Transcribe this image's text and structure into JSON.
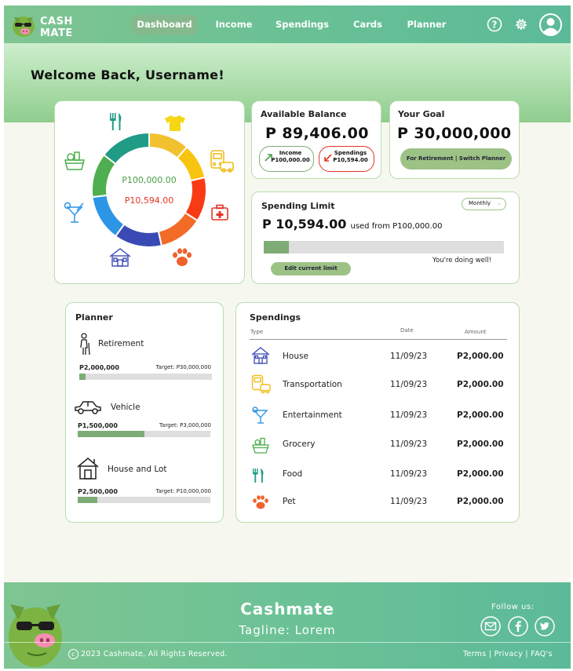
{
  "brand": {
    "line1": "CASH",
    "line2": "MATE"
  },
  "nav": [
    {
      "label": "Dashboard",
      "active": true
    },
    {
      "label": "Income"
    },
    {
      "label": "Spendings"
    },
    {
      "label": "Cards"
    },
    {
      "label": "Planner"
    }
  ],
  "header_icons": [
    "help-icon",
    "settings-gear-icon",
    "user-avatar-icon"
  ],
  "welcome": "Welcome Back, Username!",
  "donut": {
    "income": "P100,000.00",
    "spent": "P10,594.00",
    "segments": [
      {
        "name": "Clothing",
        "color": "#f2c12e",
        "frac": 0.115
      },
      {
        "name": "Transportation",
        "color": "#f8c40f",
        "frac": 0.1
      },
      {
        "name": "Health",
        "color": "#f83b14",
        "frac": 0.125
      },
      {
        "name": "Pet",
        "color": "#f26b27",
        "frac": 0.125
      },
      {
        "name": "House",
        "color": "#3a4ab5",
        "frac": 0.135
      },
      {
        "name": "Entertainment",
        "color": "#2d95e6",
        "frac": 0.13
      },
      {
        "name": "Grocery",
        "color": "#4fae4f",
        "frac": 0.125
      },
      {
        "name": "Food",
        "color": "#1f9b86",
        "frac": 0.145
      }
    ]
  },
  "balance": {
    "title": "Available Balance",
    "amount": "P 89,406.00",
    "income_label": "Income",
    "income_value": "P100,000.00",
    "spendings_label": "Spendings",
    "spendings_value": "P10,594.00"
  },
  "goal": {
    "title": "Your Goal",
    "amount": "P 30,000,000",
    "button": "For Retirement | Switch Planner"
  },
  "limit": {
    "title": "Spending Limit",
    "period": "Monthly",
    "used": "P 10,594.00",
    "used_from": "used from P100,000.00",
    "progress": 0.106,
    "message": "You're doing well!",
    "button": "Edit current limit"
  },
  "planner": {
    "title": "Planner",
    "items": [
      {
        "name": "Retirement",
        "icon": "elderly-person-icon",
        "saved": "P2,000,000",
        "target": "Target: P30,000,000",
        "progress": 0.05
      },
      {
        "name": "Vehicle",
        "icon": "car-icon",
        "saved": "P1,500,000",
        "target": "Target: P3,000,000",
        "progress": 0.5
      },
      {
        "name": "House and Lot",
        "icon": "house-icon",
        "saved": "P2,500,000",
        "target": "Target: P10,000,000",
        "progress": 0.15
      }
    ]
  },
  "spendings": {
    "title": "Spendings",
    "headers": {
      "type": "Type",
      "date": "Date",
      "amount": "Amount"
    },
    "rows": [
      {
        "type": "House",
        "date": "11/09/23",
        "amount": "P2,000.00",
        "icon": "house-icon"
      },
      {
        "type": "Transportation",
        "date": "11/09/23",
        "amount": "P2,000.00",
        "icon": "bus-icon"
      },
      {
        "type": "Entertainment",
        "date": "11/09/23",
        "amount": "P2,000.00",
        "icon": "cocktail-icon"
      },
      {
        "type": "Grocery",
        "date": "11/09/23",
        "amount": "P2,000.00",
        "icon": "grocery-basket-icon"
      },
      {
        "type": "Food",
        "date": "11/09/23",
        "amount": "P2,000.00",
        "icon": "fork-knife-icon"
      },
      {
        "type": "Pet",
        "date": "11/09/23",
        "amount": "P2,000.00",
        "icon": "paw-icon"
      }
    ]
  },
  "footer": {
    "brand": "Cashmate",
    "tagline": "Tagline: Lorem",
    "follow": "Follow us:",
    "copyright": "2023 Cashmate, All Rights Reserved.",
    "links": "Terms | Privacy | FAQ's"
  },
  "colors": {
    "accent": "#7eab76",
    "border": "#b9dcb0",
    "red": "#e53325",
    "green_text": "#4a9f4a"
  }
}
